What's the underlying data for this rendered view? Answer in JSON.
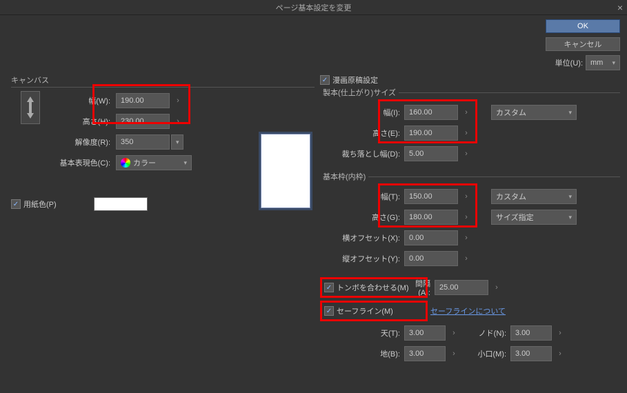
{
  "title": "ページ基本設定を変更",
  "ok": "OK",
  "cancel": "キャンセル",
  "unit_label": "単位(U):",
  "unit_value": "mm",
  "canvas": {
    "legend": "キャンバス",
    "width_label": "幅(W):",
    "width": "190.00",
    "height_label": "高さ(H):",
    "height": "230.00",
    "res_label": "解像度(R):",
    "res": "350",
    "color_label": "基本表現色(C):",
    "color_value": "カラー",
    "paper_label": "用紙色(P)"
  },
  "manga": {
    "check_label": "漫画原稿設定",
    "bind_legend": "製本(仕上がり)サイズ",
    "bind_w_label": "幅(I):",
    "bind_w": "160.00",
    "bind_h_label": "高さ(E):",
    "bind_h": "190.00",
    "bind_preset": "カスタム",
    "bleed_label": "裁ち落とし幅(D):",
    "bleed": "5.00",
    "frame_legend": "基本枠(内枠)",
    "frame_w_label": "幅(T):",
    "frame_w": "150.00",
    "frame_h_label": "高さ(G):",
    "frame_h": "180.00",
    "frame_preset": "カスタム",
    "size_spec": "サイズ指定",
    "hoff_label": "横オフセット(X):",
    "hoff": "0.00",
    "voff_label": "縦オフセット(Y):",
    "voff": "0.00",
    "tombo_label": "トンボを合わせる(M)",
    "gap_label": "間隔(A):",
    "gap": "25.00",
    "safe_label": "セーフライン(M)",
    "safe_link": "セーフラインについて",
    "ten_label": "天(T):",
    "ten": "3.00",
    "nodo_label": "ノド(N):",
    "nodo": "3.00",
    "chi_label": "地(B):",
    "chi": "3.00",
    "koguchi_label": "小口(M):",
    "koguchi": "3.00"
  }
}
